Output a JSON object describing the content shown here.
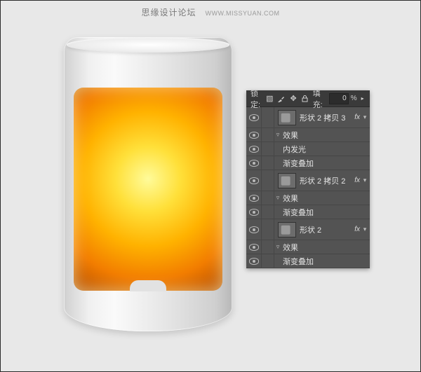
{
  "watermark": {
    "text": "思缘设计论坛",
    "url_text": "WWW.MISSYUAN.COM"
  },
  "panel": {
    "header": {
      "lock_label": "锁定:",
      "fill_label": "填充:",
      "fill_value": "0",
      "fill_pct": "%"
    },
    "fx_label": "fx",
    "effects_label": "效果",
    "layers": [
      {
        "name": "形状 2 拷贝 3",
        "has_fx": true,
        "fx_expanded": true,
        "effects": [
          "内发光",
          "渐变叠加"
        ]
      },
      {
        "name": "形状 2 拷贝 2",
        "has_fx": true,
        "fx_expanded": true,
        "effects": [
          "渐变叠加"
        ]
      },
      {
        "name": "形状 2",
        "has_fx": true,
        "fx_expanded": true,
        "effects": [
          "渐变叠加"
        ]
      }
    ]
  }
}
